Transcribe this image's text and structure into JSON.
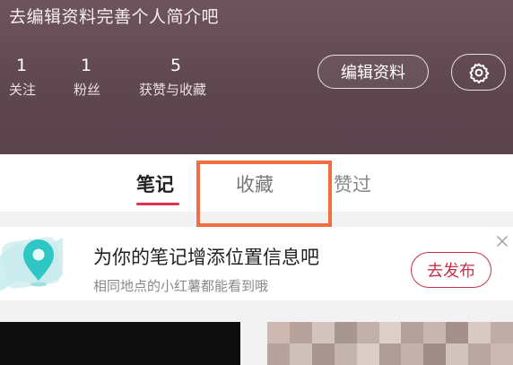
{
  "profile": {
    "bio": "去编辑资料完善个人简介吧",
    "stats": [
      {
        "value": "1",
        "label": "关注"
      },
      {
        "value": "1",
        "label": "粉丝"
      },
      {
        "value": "5",
        "label": "获赞与收藏"
      }
    ],
    "edit_label": "编辑资料",
    "settings_icon": "gear-icon"
  },
  "tabs": [
    {
      "label": "笔记",
      "active": true
    },
    {
      "label": "收藏",
      "highlighted": true
    },
    {
      "label": "赞过"
    }
  ],
  "tip": {
    "icon": "location-pin-icon",
    "title": "为你的笔记增添位置信息吧",
    "subtitle": "相同地点的小红薯都能看到哦",
    "button_label": "去发布",
    "close_icon": "close-icon"
  },
  "colors": {
    "accent": "#e0304a",
    "highlight_box": "#ef6e44",
    "header_bg": "#5f4750"
  }
}
